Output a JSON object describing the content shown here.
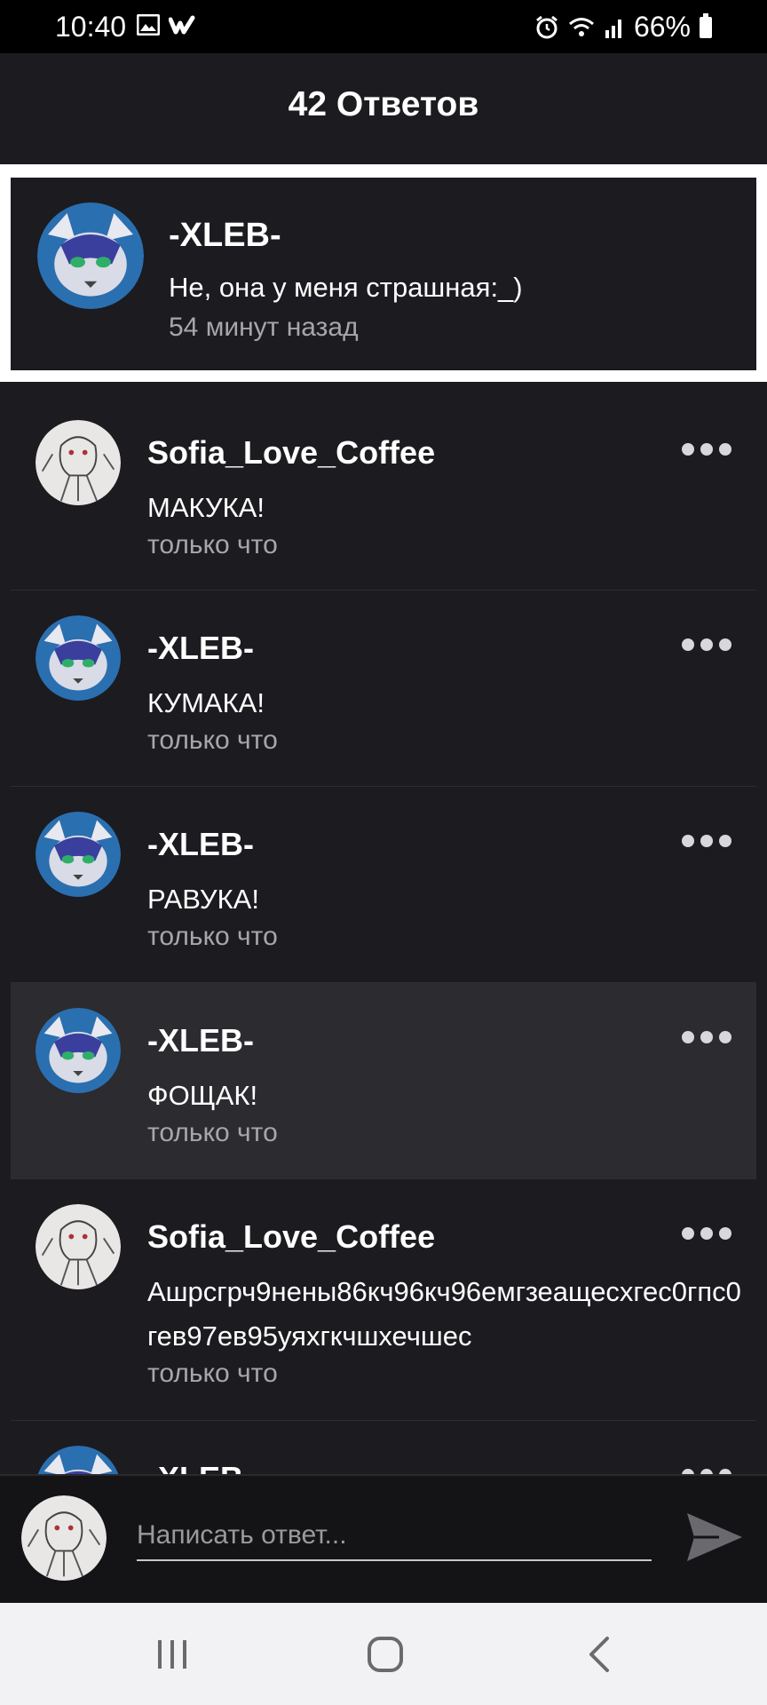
{
  "status_bar": {
    "time": "10:40",
    "battery": "66%",
    "icons": [
      "gallery-icon",
      "wattpad-icon",
      "alarm-icon",
      "wifi-icon",
      "signal-icon",
      "battery-icon"
    ]
  },
  "header": {
    "title": "42 Ответов"
  },
  "original_post": {
    "author": "-XLEB-",
    "text": "Не, она у меня страшная:_)",
    "time": "54 минут назад"
  },
  "replies": [
    {
      "author": "Sofia_Love_Coffee",
      "text": "МАКУКА!",
      "time": "только что",
      "avatar": "sketch"
    },
    {
      "author": "-XLEB-",
      "text": "КУМАКА!",
      "time": "только что",
      "avatar": "cat"
    },
    {
      "author": "-XLEB-",
      "text": "РАВУКА!",
      "time": "только что",
      "avatar": "cat"
    },
    {
      "author": "-XLEB-",
      "text": "ФОЩАК!",
      "time": "только что",
      "avatar": "cat",
      "highlighted": true
    },
    {
      "author": "Sofia_Love_Coffee",
      "text": "Ашрсгрч9нены86кч96кч96емгзеащесхгес0гпс0гев97ев95уяхгкчшхечшес",
      "time": "только что",
      "avatar": "sketch"
    },
    {
      "author": "-XLEB-",
      "text": "",
      "time": "",
      "avatar": "cat",
      "partial": true
    }
  ],
  "compose": {
    "placeholder": "Написать ответ..."
  },
  "colors": {
    "background": "#1c1b1f",
    "highlight": "#2c2b30",
    "secondary_text": "#a7a7ab"
  }
}
